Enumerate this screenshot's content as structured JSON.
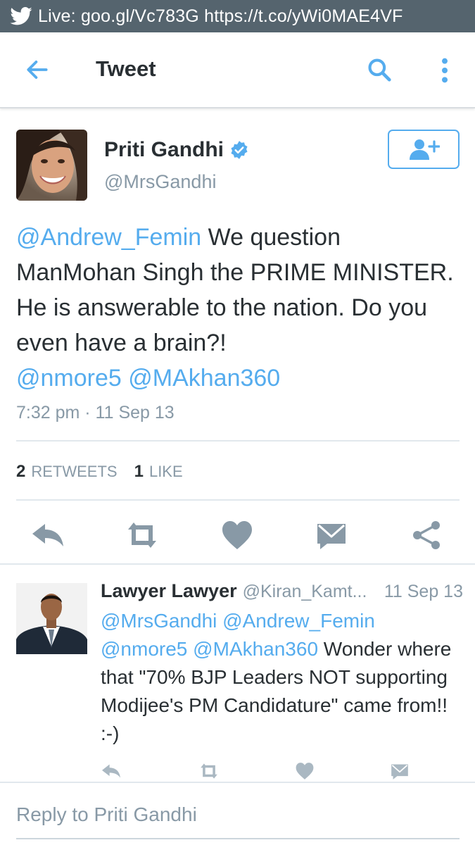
{
  "status_bar": {
    "text": "Live: goo.gl/Vc783G https://t.co/yWi0MAE4VF",
    "icon": "twitter-bird-icon"
  },
  "app_bar": {
    "title": "Tweet",
    "icons": [
      "back-arrow-icon",
      "search-icon",
      "more-vertical-icon"
    ]
  },
  "tweet": {
    "author_name": "Priti Gandhi",
    "author_handle": "@MrsGandhi",
    "verified": true,
    "text": {
      "mention1": "@Andrew_Femin",
      "body": " We question ManMohan Singh the PRIME MINISTER. He is answerable to the nation. Do you even have a brain?!",
      "mention2": "@nmore5",
      "mention3": "@MAkhan360"
    },
    "timestamp": "7:32 pm · 11 Sep 13",
    "retweets_count": "2",
    "retweets_label": "RETWEETS",
    "likes_count": "1",
    "likes_label": "LIKE"
  },
  "reply": {
    "author_name": "Lawyer Lawyer",
    "author_handle": "@Kiran_Kamt...",
    "date": "11 Sep 13",
    "text": {
      "mention1": "@MrsGandhi",
      "mention2": "@Andrew_Femin",
      "mention3": "@nmore5",
      "mention4": "@MAkhan360",
      "body": " Wonder where that \"70% BJP Leaders NOT supporting Modijee's PM Candidature\" came from!! :-)"
    }
  },
  "reply_box": {
    "placeholder": "Reply to Priti Gandhi"
  },
  "colors": {
    "accent": "#55acee",
    "status_bar": "#55646e",
    "secondary_text": "#8899a6",
    "icon_gray": "#8899a6"
  }
}
